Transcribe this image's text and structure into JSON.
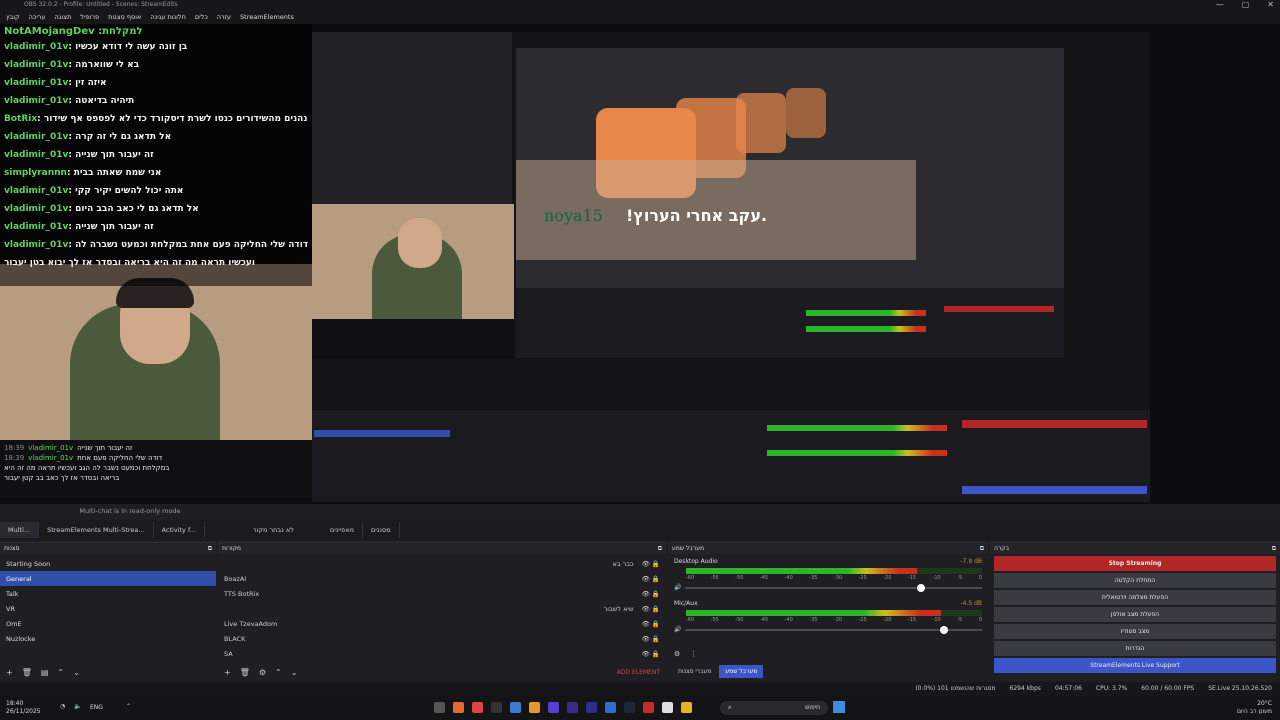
{
  "window": {
    "title": "OBS 32.0.2 - Profile: Untitled - Scenes: StreamEdits",
    "controls": [
      "—",
      "▢",
      "✕"
    ]
  },
  "menubar": [
    "קובץ",
    "עריכה",
    "תצוגה",
    "פרופיל",
    "אוסף סצנות",
    "חלונות עגינה",
    "כלים",
    "עזרה",
    "StreamElements"
  ],
  "overlay_chat": {
    "header": "NotAMojangDev :למקלחת",
    "rows": [
      {
        "user": "vladimir_01v",
        "msg": ": בן זונה עשה לי דודא עכשיו"
      },
      {
        "user": "vladimir_01v",
        "msg": ": בא לי שווארמה"
      },
      {
        "user": "vladimir_01v",
        "msg": ": איזה זין"
      },
      {
        "user": "vladimir_01v",
        "msg": ": תיהיה בדיאטה"
      },
      {
        "user": "BotRix",
        "msg": ": אם אתם נהנים מהשידורים כנסו לשרת דיסקורד כדי לא לפספס אף שידור https://discord.gg/rs6tD7ghft"
      },
      {
        "user": "vladimir_01v",
        "msg": ": אל תדאג גם לי זה קרה"
      },
      {
        "user": "vladimir_01v",
        "msg": ": זה יעבור תוך שנייה"
      },
      {
        "user": "simplyrannn",
        "msg": ": אני שמח שאתה בבית"
      },
      {
        "user": "vladimir_01v",
        "msg": ": אתה יכול להשים יקיר קקי"
      },
      {
        "user": "vladimir_01v",
        "msg": ": אל תדאג גם לי כאב הבב היום"
      },
      {
        "user": "vladimir_01v",
        "msg": ": זה יעבור תוך שנייה"
      },
      {
        "user": "vladimir_01v",
        "msg": ": דודה שלי החליקה פעם אחת במקלחת וכמעט נשברה לה"
      },
      {
        "user": "",
        "msg": "ועכשיו תראה מה זה היא בריאה ובסדר אז לך יבוא בטן יעבור"
      }
    ]
  },
  "preview_overlay": {
    "watermark_name": "noya15",
    "caption": "!עקב אחרי הערוץ."
  },
  "lower_chat": {
    "rows": [
      {
        "time": "18:39",
        "user": "vladimir_01v",
        "msg": "זה יעבור תוך שנייה"
      },
      {
        "time": "18:39",
        "user": "vladimir_01v",
        "msg": "דודה שלי החליקה פעם אחת"
      },
      {
        "time": "",
        "user": "",
        "msg": "במקלחת וכמעט נשבר לה הגב ועכשיו תראה מה זה היא"
      },
      {
        "time": "",
        "user": "",
        "msg": "בריאה ובסדר אז לך כאב בב קטן יעבור"
      }
    ]
  },
  "multichat_notice": "Multi-chat is in read-only mode",
  "dock_tabs": [
    "Multi...",
    "StreamElements Multi-Strea...",
    "Activity f...",
    "לא נבחר מקור",
    "מאפיינים",
    "מסננים"
  ],
  "scenes": {
    "title": "סצנות",
    "items": [
      "Starting Soon",
      "General",
      "Talk",
      "VR",
      "OmE",
      "Nuzlocke"
    ],
    "selected": 1
  },
  "sources": {
    "title": "מקורות",
    "items": [
      {
        "name": "כבר בא",
        "right": true
      },
      {
        "name": "BoazAI",
        "right": false
      },
      {
        "name": "TTS BotRix",
        "right": false
      },
      {
        "name": "שיא לשבור",
        "right": true
      },
      {
        "name": "Live TzevaAdom",
        "right": false
      },
      {
        "name": "BLACK",
        "right": false
      },
      {
        "name": "SA",
        "right": false
      }
    ]
  },
  "mixer": {
    "title": "מערבל שמע",
    "channels": [
      {
        "name": "Desktop Audio",
        "db": "-7.9 dB",
        "level": 0.78
      },
      {
        "name": "Mic/Aux",
        "db": "-4.5 dB",
        "level": 0.86
      }
    ],
    "ticks": [
      "-60",
      "-55",
      "-50",
      "-45",
      "-40",
      "-35",
      "-30",
      "-25",
      "-20",
      "-15",
      "-10",
      "-5",
      "0"
    ],
    "tabs": [
      "מערבל שמע",
      "מעברי סצנות"
    ],
    "add_element": "ADD ELEMENT"
  },
  "controls": {
    "title": "בקרה",
    "buttons": [
      "Stop Streaming",
      "התחלת הקלטה",
      "הפעלת מצלמה וירטואלית",
      "הפעלת מצב אולפן",
      "מצב סטודיו",
      "הגדרות"
    ],
    "support": "StreamElements Live Support"
  },
  "statusbar": {
    "dropped": "(0.0%) 101 מסגרות שהושמטו",
    "kbps": "6294 kbps",
    "time": "04:57:06",
    "cpu": "CPU: 3.7%",
    "fps": "60.00 / 60.00 FPS",
    "version": "SE.Live 25.10.26.520"
  },
  "taskbar": {
    "time": "18:40",
    "date": "26/11/2025",
    "lang": "ENG",
    "search": "חיפוש",
    "weather": "20°C",
    "weather_text": "מעונן רב היום"
  },
  "colors": {
    "accent": "#2e50a8",
    "stop": "#b32626",
    "meter_green": "#2ab52a",
    "chat_user": "#5fd35f"
  }
}
